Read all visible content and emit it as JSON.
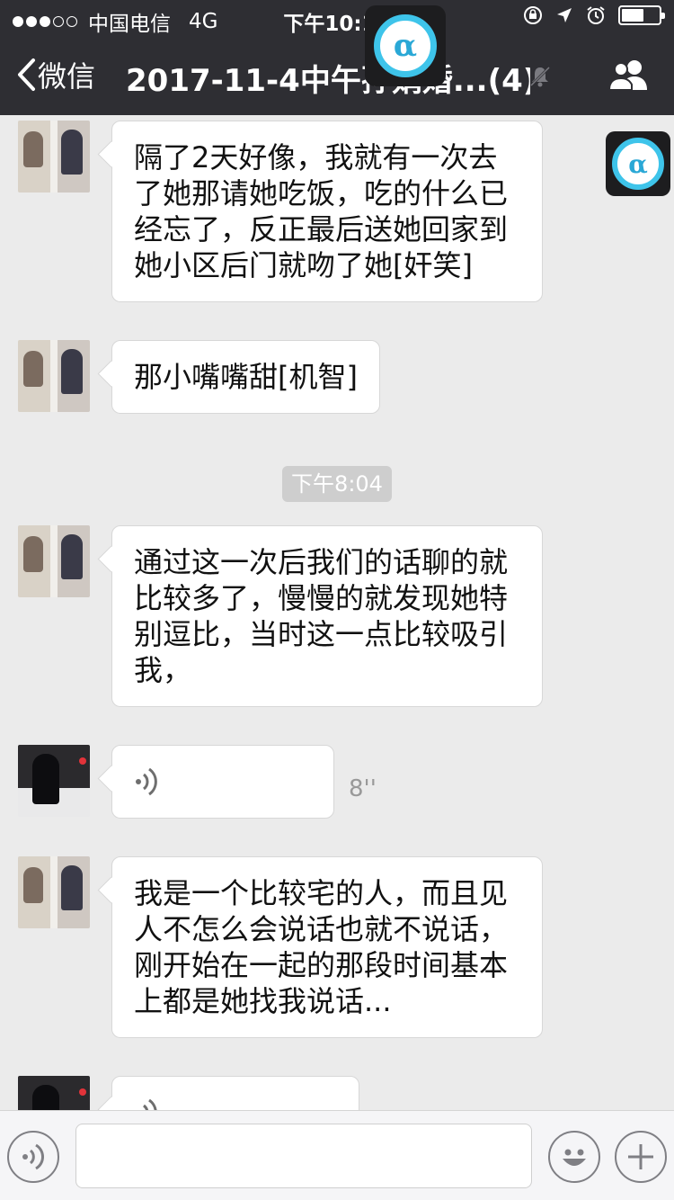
{
  "status_bar": {
    "carrier": "中国电信",
    "network": "4G",
    "time": "下午10:17",
    "battery_level": 0.6
  },
  "nav": {
    "back_label": "微信",
    "title": "2017-11-4中午孙娟婚...(4)"
  },
  "overlay_badge": {
    "symbol": "α"
  },
  "messages": [
    {
      "kind": "text",
      "avatar": "wedding-photo",
      "text": "隔了2天好像，我就有一次去了她那请她吃饭，吃的什么已经忘了，反正最后送她回家到她小区后门就吻了她[奸笑]"
    },
    {
      "kind": "text",
      "avatar": "wedding-photo",
      "text": "那小嘴嘴甜[机智]"
    },
    {
      "kind": "text",
      "avatar": "wedding-photo",
      "text": "通过这一次后我们的话聊的就比较多了，慢慢的就发现她特别逗比，当时这一点比较吸引我，"
    },
    {
      "kind": "voice",
      "avatar": "piano-player",
      "duration": "8''"
    },
    {
      "kind": "text",
      "avatar": "wedding-photo",
      "text": "我是一个比较宅的人，而且见人不怎么会说话也就不说话，刚开始在一起的那段时间基本上都是她找我说话..."
    },
    {
      "kind": "voice",
      "avatar": "piano-player",
      "duration": ""
    }
  ],
  "timestamp": "下午8:04",
  "input_bar": {
    "placeholder": "",
    "voice_icon": "voice-mode-icon",
    "emoji_icon": "emoji-icon",
    "plus_icon": "plus-icon"
  },
  "colors": {
    "nav_bg": "#2e2e33",
    "chat_bg": "#ebebeb",
    "bubble_bg": "#ffffff",
    "accent_alpha": "#3ec4ea"
  }
}
